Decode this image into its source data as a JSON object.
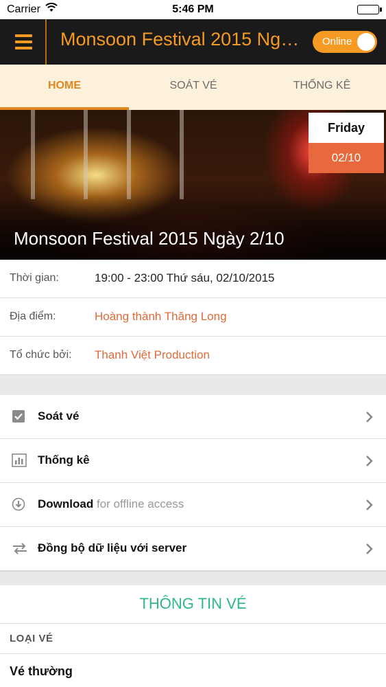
{
  "status_bar": {
    "carrier": "Carrier",
    "time": "5:46 PM"
  },
  "nav": {
    "title": "Monsoon Festival 2015 Ngày ...",
    "toggle_label": "Online",
    "toggle_on": true
  },
  "tabs": [
    {
      "label": "HOME",
      "active": true
    },
    {
      "label": "SOÁT VÉ",
      "active": false
    },
    {
      "label": "THỐNG KÊ",
      "active": false
    }
  ],
  "hero": {
    "title": "Monsoon Festival 2015 Ngày 2/10",
    "badge_day": "Friday",
    "badge_date": "02/10"
  },
  "event_info": [
    {
      "label": "Thời gian:",
      "value": "19:00 - 23:00 Thứ sáu, 02/10/2015",
      "is_link": false
    },
    {
      "label": "Địa điểm:",
      "value": "Hoàng thành Thăng Long",
      "is_link": true
    },
    {
      "label": "Tổ chức bởi:",
      "value": "Thanh Việt Production",
      "is_link": true
    }
  ],
  "menu": [
    {
      "label": "Soát vé",
      "sub": "",
      "icon": "checkbox-icon"
    },
    {
      "label": "Thống kê",
      "sub": "",
      "icon": "bar-chart-icon"
    },
    {
      "label": "Download",
      "sub": "for offline access",
      "icon": "download-icon"
    },
    {
      "label": "Đồng bộ dữ liệu với server",
      "sub": "",
      "icon": "sync-icon"
    }
  ],
  "ticket_info": {
    "title": "THÔNG TIN VÉ",
    "type_header": "LOẠI VÉ",
    "types": [
      "Vé thường"
    ]
  },
  "colors": {
    "accent_orange": "#f59a23",
    "badge_red": "#e8693d",
    "link_orange": "#e06a38",
    "ticket_green": "#2eb88a"
  }
}
